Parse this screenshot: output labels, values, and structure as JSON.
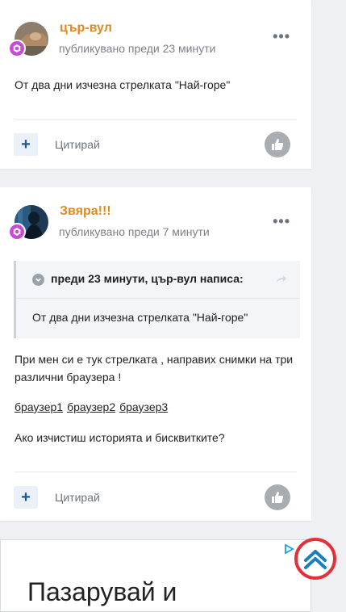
{
  "posts": [
    {
      "author": "цър-вул",
      "published": "публикувано преди 23 минути",
      "content": "От два дни изчезна стрелката \"Най-горе\"",
      "quote_label": "Цитирай"
    },
    {
      "author": "Звяра!!!",
      "published": "публикувано преди 7 минути",
      "quote_header": "преди 23 минути, цър-вул написа:",
      "quote_text": "От два дни изчезна стрелката \"Най-горе\"",
      "content": "При мен си е тук стрелката , направих снимки на три различни браузера !",
      "links": [
        "браузер1",
        "браузер2",
        "браузер3"
      ],
      "question": "Ако изчистиш историята и бисквитките?",
      "quote_label": "Цитирай"
    }
  ],
  "ad": {
    "headline": "Пазарувай и"
  },
  "colors": {
    "author": "#e08a1e",
    "scroll_top_ring": "#e3313a",
    "badge": "#c74bd6"
  }
}
